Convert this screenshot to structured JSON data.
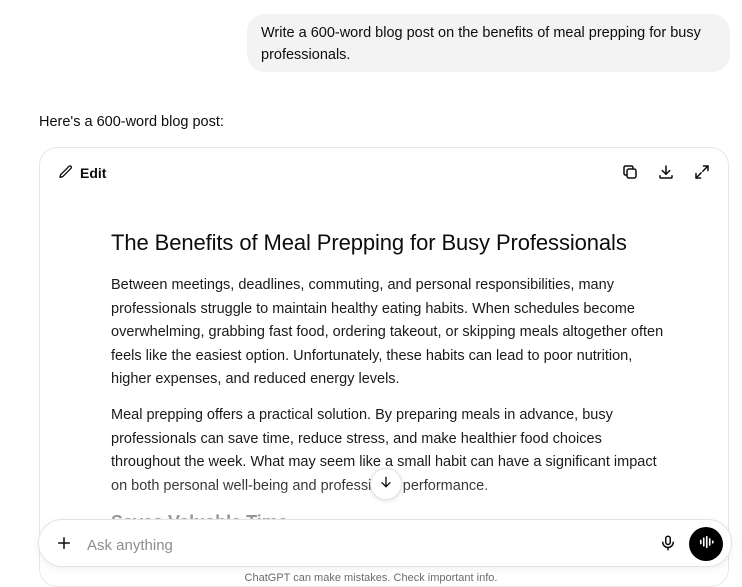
{
  "user_message": "Write a 600-word blog post on the benefits of meal prepping for busy professionals.",
  "assistant_intro": "Here's a 600-word blog post:",
  "canvas": {
    "edit_label": "Edit",
    "actions": [
      "copy-icon",
      "download-icon",
      "expand-icon"
    ],
    "title": "The Benefits of Meal Prepping for Busy Professionals",
    "paragraphs": [
      "Between meetings, deadlines, commuting, and personal responsibilities, many professionals struggle to maintain healthy eating habits. When schedules become overwhelming, grabbing fast food, ordering takeout, or skipping meals altogether often feels like the easiest option. Unfortunately, these habits can lead to poor nutrition, higher expenses, and reduced energy levels.",
      "Meal prepping offers a practical solution. By preparing meals in advance, busy professionals can save time, reduce stress, and make healthier food choices throughout the week. What may seem like a small habit can have a significant impact on both personal well-being and professional performance."
    ],
    "subheading": "Saves Valuable Time"
  },
  "composer": {
    "placeholder": "Ask anything"
  },
  "footer_note": "ChatGPT can make mistakes. Check important info."
}
